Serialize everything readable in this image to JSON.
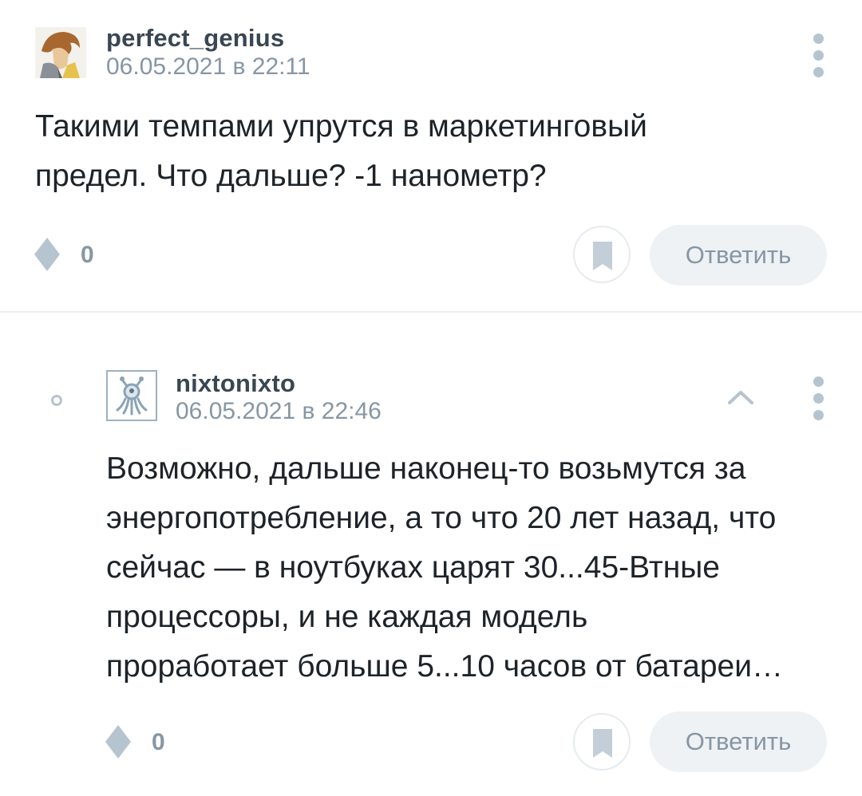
{
  "comments": [
    {
      "author": "perfect_genius",
      "date": "06.05.2021 в 22:11",
      "lines": [
        "Такими темпами упрутся в маркетинговый",
        "предел. Что дальше? -1 нанометр?"
      ],
      "votes": "0",
      "reply_label": "Ответить"
    },
    {
      "author": "nixtonixto",
      "date": "06.05.2021 в 22:46",
      "lines": [
        "Возможно, дальше наконец-то возьмутся за",
        "энергопотребление, а то что 20 лет назад, что",
        "сейчас — в ноутбуках царят 30...45-Втные",
        "процессоры, и не каждая модель",
        "проработает больше 5...10 часов от батареи…"
      ],
      "votes": "0",
      "reply_label": "Ответить"
    }
  ],
  "icons": {
    "vote": "vote-diamond-icon",
    "bookmark": "bookmark-icon",
    "menu": "more-vertical-icon",
    "collapse": "chevron-up-icon",
    "thread": "thread-bullet-icon"
  },
  "colors": {
    "text": "#1d2328",
    "author": "#3a4652",
    "muted": "#8796a4",
    "icon": "#b6c4cf",
    "button_bg": "#eef2f5"
  }
}
